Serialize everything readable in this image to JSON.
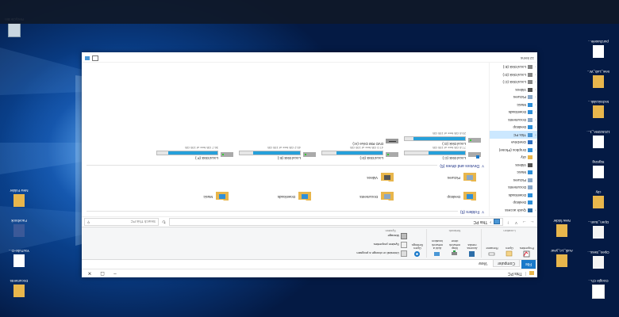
{
  "desktop": {
    "recycle_bin": "Recycle Bin",
    "icons_left": [
      "Google Ch...",
      "Open_Sess...",
      "Open_Sam...",
      "city",
      "Signing",
      "1215228A_1...",
      "technicalsk...",
      "new_Lab_W...",
      "purchasele..."
    ],
    "icons_right": [
      "Documents",
      "YouTube-D...",
      "Facebook",
      "New Folder"
    ],
    "icons_mid": [
      "Audi_Lo_year",
      "New folder"
    ]
  },
  "window": {
    "title": "This PC",
    "tabs": [
      "File",
      "Computer",
      "View"
    ],
    "ribbon": {
      "location": {
        "name": "Location",
        "buttons": [
          "Properties",
          "Open",
          "Rename"
        ]
      },
      "network": {
        "name": "Network",
        "buttons": [
          "Access media",
          "Map network drive",
          "Add a network location"
        ]
      },
      "system": {
        "name": "System",
        "open_settings": "Open Settings",
        "cmds": [
          "Uninstall or change a program",
          "System properties",
          "Manage"
        ]
      }
    },
    "address": {
      "path": "This PC",
      "search_placeholder": "Search This PC"
    },
    "nav": [
      {
        "label": "Quick access",
        "exp": "˅",
        "icon": "star-icon",
        "color": "#2d6ea8"
      },
      {
        "label": "Desktop",
        "exp": "",
        "icon": "desktop-icon",
        "color": "#2f8fd8"
      },
      {
        "label": "Downloads",
        "exp": "",
        "icon": "download-icon",
        "color": "#2f8fd8"
      },
      {
        "label": "Documents",
        "exp": "",
        "icon": "documents-icon",
        "color": "#8aa8c8"
      },
      {
        "label": "Pictures",
        "exp": "",
        "icon": "pictures-icon",
        "color": "#8aa8c8"
      },
      {
        "label": "Music",
        "exp": "",
        "icon": "music-icon",
        "color": "#2f8fd8"
      },
      {
        "label": "Videos",
        "exp": "",
        "icon": "videos-icon",
        "color": "#555555"
      },
      {
        "label": "city",
        "exp": "",
        "icon": "folder-icon",
        "color": "#e8b64c"
      },
      {
        "label": "Dropbox (Phone)",
        "exp": "›",
        "icon": "dropbox-icon",
        "color": "#2f8fd8"
      },
      {
        "label": "OneDrive",
        "exp": "›",
        "icon": "onedrive-icon",
        "color": "#2f6fc0"
      },
      {
        "label": "This PC",
        "exp": "˅",
        "icon": "pc-icon",
        "color": "#4a97d6"
      },
      {
        "label": "Desktop",
        "exp": "›",
        "icon": "desktop-icon",
        "color": "#2f8fd8"
      },
      {
        "label": "Documents",
        "exp": "›",
        "icon": "documents-icon",
        "color": "#8aa8c8"
      },
      {
        "label": "Downloads",
        "exp": "›",
        "icon": "download-icon",
        "color": "#2f8fd8"
      },
      {
        "label": "Music",
        "exp": "›",
        "icon": "music-icon",
        "color": "#2f8fd8"
      },
      {
        "label": "Pictures",
        "exp": "›",
        "icon": "pictures-icon",
        "color": "#8aa8c8"
      },
      {
        "label": "Videos",
        "exp": "›",
        "icon": "videos-icon",
        "color": "#555555"
      },
      {
        "label": "Local Disk (C:)",
        "exp": "›",
        "icon": "disk-icon",
        "color": "#888888"
      },
      {
        "label": "Local Disk (D:)",
        "exp": "›",
        "icon": "disk-icon",
        "color": "#888888"
      },
      {
        "label": "Local Disk (E:)",
        "exp": "›",
        "icon": "disk-icon",
        "color": "#888888"
      },
      {
        "label": "Local Disk (F:)",
        "exp": "›",
        "icon": "disk-icon",
        "color": "#888888"
      },
      {
        "label": "Local Disk (G:)",
        "exp": "›",
        "icon": "disk-icon",
        "color": "#888888"
      },
      {
        "label": "Network",
        "exp": "›",
        "icon": "network-icon",
        "color": "#2f8fd8"
      },
      {
        "label": "Homegroup",
        "exp": "›",
        "icon": "homegroup-icon",
        "color": "#2f8fd8"
      }
    ],
    "folders_header": "Folders (6)",
    "folders": [
      {
        "label": "Desktop",
        "color": "#2f8fd8"
      },
      {
        "label": "Documents",
        "color": "#8aa8c8"
      },
      {
        "label": "Downloads",
        "color": "#2f8fd8"
      },
      {
        "label": "Music",
        "color": "#2f8fd8"
      },
      {
        "label": "Pictures",
        "color": "#8aa8c8"
      },
      {
        "label": "Videos",
        "color": "#555555"
      }
    ],
    "drives_header": "Devices and drives (6)",
    "drives": [
      {
        "label": "Local Disk (C:)",
        "free": "77.8 GB free of 195 GB",
        "used_fraction": 0.6,
        "type": "system"
      },
      {
        "label": "Local Disk (D:)",
        "free": "47.0 GB free of 195 GB",
        "used_fraction": 0.76,
        "type": "disk"
      },
      {
        "label": "Local Disk (E:)",
        "free": "45.2 GB free of 195 GB",
        "used_fraction": 0.77,
        "type": "disk"
      },
      {
        "label": "Local Disk (F:)",
        "free": "36.7 GB free of 195 GB",
        "used_fraction": 0.81,
        "type": "disk"
      },
      {
        "label": "Local Disk (G:)",
        "free": "29.8 GB free of 195 GB",
        "used_fraction": 0.85,
        "type": "disk"
      },
      {
        "label": "DVD RW Drive (H:)",
        "free": "",
        "used_fraction": null,
        "type": "dvd"
      }
    ],
    "status": {
      "count": "12 items"
    }
  },
  "colors": {
    "accent": "#1979ca",
    "bar_fill": "#26a0da",
    "folder": "#e8b64c"
  }
}
